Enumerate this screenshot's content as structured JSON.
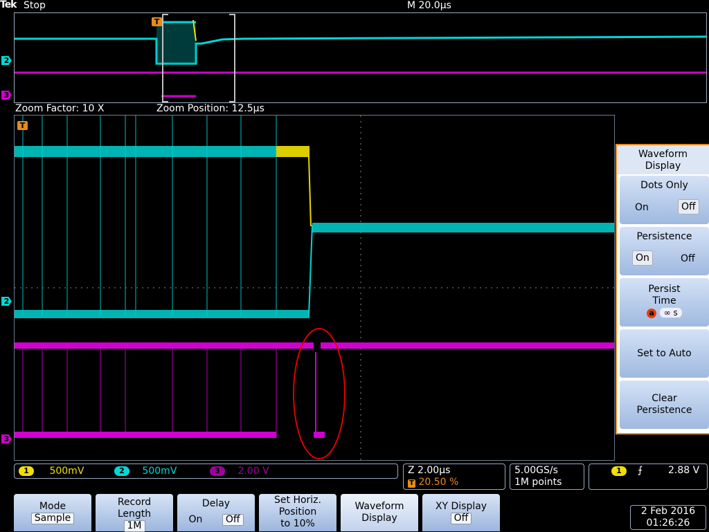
{
  "header": {
    "logo": "Tek",
    "run_status": "Stop",
    "timebase": "M 20.0µs"
  },
  "zoom": {
    "factor": "Zoom Factor: 10 X",
    "position": "Zoom Position: 12.5µs"
  },
  "markers": {
    "trigger": "T",
    "ch2": "2",
    "ch3": "3"
  },
  "colors": {
    "ch1": "#f0e000",
    "ch2": "#00d8d8",
    "ch3": "#d000d0",
    "annotation": "#e00000",
    "menu_border": "#e88b1a"
  },
  "side_menu": {
    "title_line1": "Waveform",
    "title_line2": "Display",
    "dots_only": {
      "label": "Dots Only",
      "on": "On",
      "off": "Off",
      "selected": "Off"
    },
    "persistence": {
      "label": "Persistence",
      "on": "On",
      "off": "Off",
      "selected": "On"
    },
    "persist_time": {
      "label_line1": "Persist",
      "label_line2": "Time",
      "knob": "a",
      "value": "∞ s"
    },
    "set_to_auto": "Set to Auto",
    "clear_persistence_line1": "Clear",
    "clear_persistence_line2": "Persistence"
  },
  "channels": {
    "ch1": {
      "num": "1",
      "scale": "500mV"
    },
    "ch2": {
      "num": "2",
      "scale": "500mV"
    },
    "ch3": {
      "num": "3",
      "scale": "2.00 V"
    }
  },
  "horizontal": {
    "zoom_scale": "Z 2.00µs",
    "trigger_pos": "20.50 %",
    "sample_rate": "5.00GS/s",
    "record": "1M points"
  },
  "trigger": {
    "source": "1",
    "slope": "⨍",
    "level": "2.88 V"
  },
  "bottom_menu": {
    "mode": {
      "label": "Mode",
      "value": "Sample"
    },
    "record_length": {
      "label_line1": "Record",
      "label_line2": "Length",
      "value": "1M"
    },
    "delay": {
      "label": "Delay",
      "on": "On",
      "off": "Off"
    },
    "set_horiz": {
      "line1": "Set Horiz.",
      "line2": "Position",
      "line3": "to 10%"
    },
    "waveform_display": {
      "line1": "Waveform",
      "line2": "Display"
    },
    "xy_display": {
      "label": "XY Display",
      "value": "Off"
    }
  },
  "datetime": {
    "date": "2 Feb  2016",
    "time": "01:26:26"
  }
}
